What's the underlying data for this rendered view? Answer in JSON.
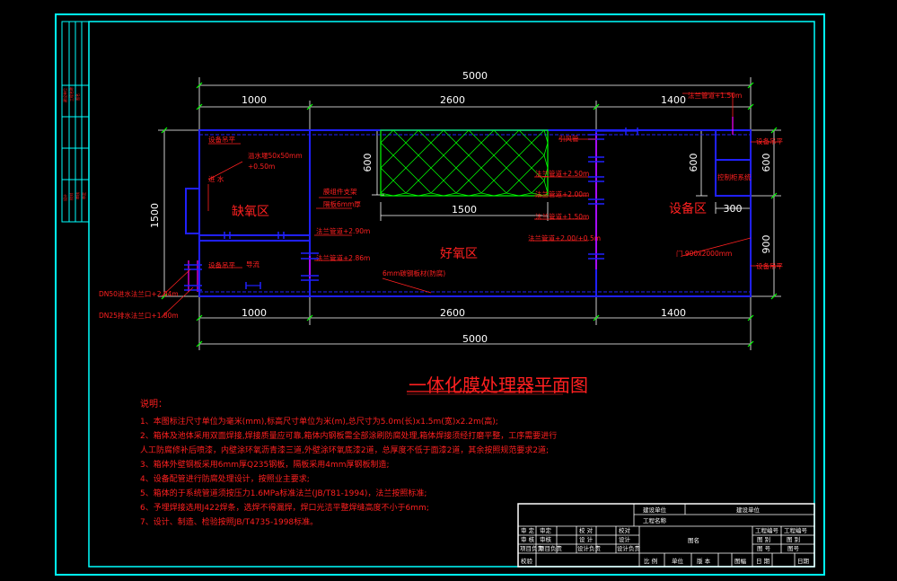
{
  "drawing": {
    "title": "一体化膜处理器平面图",
    "dims": {
      "overall_top": "5000",
      "overall_bottom": "5000",
      "seg1": "1000",
      "seg2": "2600",
      "seg3": "1400",
      "height_left": "1500",
      "dim_600_a": "600",
      "dim_600_b": "600",
      "dim_600_c": "600",
      "dim_1500": "1500",
      "dim_300": "300",
      "dim_900": "900"
    },
    "zones": {
      "anoxic": "缺氧区",
      "aerobic": "好氧区",
      "equipment": "设备区",
      "membrane_box": "膜组件"
    },
    "labels": {
      "level_top_left": "设备吊平",
      "inlet": "进 水",
      "level_mid_left": "设备吊平",
      "baffle": "导流",
      "overflow_weir": "溢水堰50x50mm",
      "overflow_weir_h": "+0.50m",
      "membrane_support": "膜组件支架",
      "partition": "隔板6mm厚",
      "pipe_290": "法兰管道+2.90m",
      "pipe_286": "法兰管道+2.86m",
      "steel_plate": "6mm碳钢板材(防腐)",
      "flange_150": "法兰管道+1.50m",
      "outlet_pipe": "引风管",
      "pipe_250": "法兰管道+2.50m",
      "pipe_200": "法兰管道+2.00m",
      "pipe_150b": "法兰管道+1.50m",
      "pipe_200_05": "法兰管道+2.00/+0.5m",
      "control_box": "控制柜系统",
      "door": "门 900x2000mm",
      "level_right_top": "设备吊平",
      "level_right_bottom": "设备吊平",
      "dn50": "DN50进水法兰口+2.04m",
      "dn25": "DN25排水法兰口+1.80m"
    },
    "notes_title": "说明：",
    "notes": [
      "1、本图标注尺寸单位为毫米(mm),标高尺寸单位为米(m),总尺寸为5.0m(长)x1.5m(宽)x2.2m(高);",
      "2、箱体及池体采用双面焊接,焊接质量应可靠,箱体内钢板需全部涂刷防腐处理,箱体焊接须经打磨平整，工序需要进行",
      "   人工防腐修补后喷漆，内壁涂环氧沥青漆三道,外壁涂环氧底漆2道，总厚度不低于面漆2道，其余按照规范要求2道;",
      "3、箱体外壁钢板采用6mm厚Q235钢板，隔板采用4mm厚钢板制造;",
      "4、设备配管进行防腐处理设计，按照业主要求;",
      "5、箱体的于系统管道须按压力1.6MPa标准法兰(JB/T81-1994)，法兰按照标准;",
      "6、予埋焊接选用J422焊条，选焊不得漏焊，焊口光洁平整焊缝高度不小于6mm;",
      "7、设计、制造、检验按照JB/T4735-1998标准。"
    ],
    "titleblock": {
      "construction_unit": "建设单位",
      "project_name": "工程名称",
      "design_unit_value": "建设单位",
      "approve": "审 定",
      "check": "审 核",
      "project_lead": "项目负责",
      "approve2": "审定",
      "check2": "审核",
      "project_lead2": "项目负责",
      "proofread": "校 对",
      "design": "设 计",
      "draw": "设计负责",
      "proofread2": "校对",
      "design2": "设计",
      "draw2": "设计负责",
      "discipline": "校验",
      "drawing_name": "图名",
      "project_no_label": "工程编号",
      "project_no_value": "工程编号",
      "drawing_no_label": "图 别",
      "drawing_no_value": "图 别",
      "sheet_label": "图 号",
      "sheet_value": "图号",
      "scale": "比 例",
      "unit": "单位",
      "version": "版 本",
      "date_label": "日 期",
      "date_value": "日期",
      "sheets": "图幅"
    },
    "side_strip": [
      "建设单位",
      "工程名称",
      "图名",
      "设计",
      "校对",
      "审核",
      "审定"
    ]
  },
  "colors": {
    "frame": "#00ffff",
    "wall": "#2020ff",
    "dim": "#ffffff",
    "text": "#ff2020",
    "grid": "#00ff00",
    "pipe": "#ff00ff",
    "background": "#000000"
  }
}
